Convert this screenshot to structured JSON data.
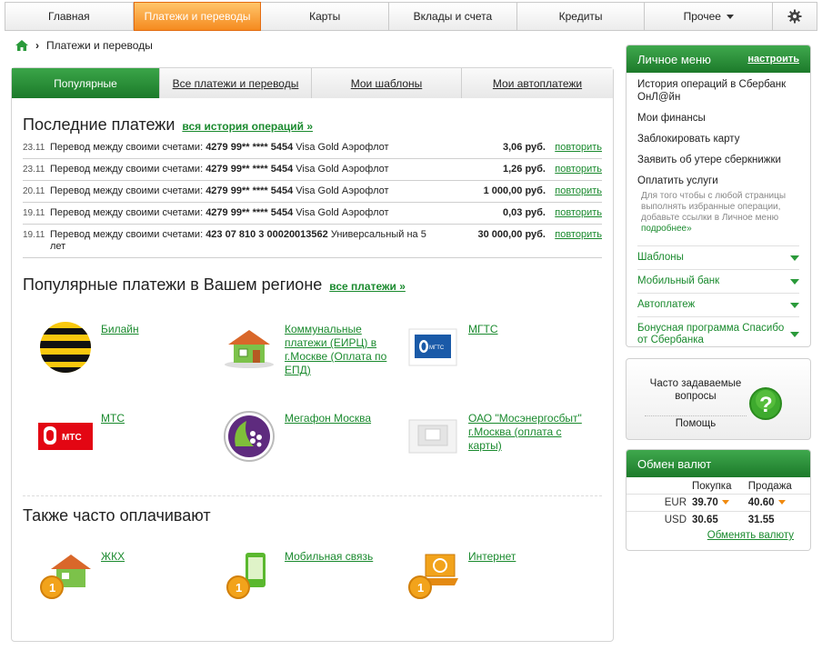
{
  "nav": {
    "items": [
      {
        "label": "Главная"
      },
      {
        "label": "Платежи и переводы"
      },
      {
        "label": "Карты"
      },
      {
        "label": "Вклады и счета"
      },
      {
        "label": "Кредиты"
      },
      {
        "label": "Прочее"
      }
    ],
    "settings_icon": "gear-icon"
  },
  "breadcrumb": {
    "home_icon": "home-icon",
    "current": "Платежи и переводы"
  },
  "tabs": [
    {
      "label": "Популярные"
    },
    {
      "label": "Все платежи и переводы"
    },
    {
      "label": "Мои шаблоны"
    },
    {
      "label": "Мои автоплатежи"
    }
  ],
  "recent": {
    "title": "Последние платежи",
    "history_link": "вся история операций »",
    "repeat_label": "повторить",
    "rows": [
      {
        "date": "23.11",
        "text": "Перевод между своими счетами:",
        "account": "4279 99** **** 5454",
        "card": "Visa Gold Аэрофлот",
        "amount": "3,06 руб."
      },
      {
        "date": "23.11",
        "text": "Перевод между своими счетами:",
        "account": "4279 99** **** 5454",
        "card": "Visa Gold Аэрофлот",
        "amount": "1,26 руб."
      },
      {
        "date": "20.11",
        "text": "Перевод между своими счетами:",
        "account": "4279 99** **** 5454",
        "card": "Visa Gold Аэрофлот",
        "amount": "1 000,00 руб."
      },
      {
        "date": "19.11",
        "text": "Перевод между своими счетами:",
        "account": "4279 99** **** 5454",
        "card": "Visa Gold Аэрофлот",
        "amount": "0,03 руб."
      },
      {
        "date": "19.11",
        "text": "Перевод между своими счетами:",
        "account": "423 07 810 3 00020013562",
        "card": "Универсальный на 5 лет",
        "amount": "30 000,00 руб."
      }
    ]
  },
  "regional": {
    "title": "Популярные платежи в Вашем регионе",
    "all_link": "все платежи »",
    "items": [
      {
        "label": "Билайн",
        "icon": "beeline-logo-icon"
      },
      {
        "label": "Коммунальные платежи (ЕИРЦ) в г.Москве (Оплата по ЕПД)",
        "icon": "house-icon"
      },
      {
        "label": "МГТС",
        "icon": "mgts-logo-icon"
      },
      {
        "label": "МТС",
        "icon": "mts-logo-icon"
      },
      {
        "label": "Мегафон Москва",
        "icon": "megafon-logo-icon"
      },
      {
        "label": "ОАО \"Мосэнергосбыт\" г.Москва (оплата с карты)",
        "icon": "mosenergosbyt-logo-icon"
      }
    ],
    "mgts_logo_text": "МГТС",
    "mts_logo_text": "МТС"
  },
  "frequent": {
    "title": "Также часто оплачивают",
    "items": [
      {
        "label": "ЖКХ",
        "icon": "house-coins-icon"
      },
      {
        "label": "Мобильная связь",
        "icon": "phone-coins-icon"
      },
      {
        "label": "Интернет",
        "icon": "laptop-coins-icon"
      }
    ]
  },
  "personal_menu": {
    "title": "Личное меню",
    "configure": "настроить",
    "links": [
      {
        "label": "История операций в Сбербанк ОнЛ@йн"
      },
      {
        "label": "Мои финансы"
      },
      {
        "label": "Заблокировать карту"
      },
      {
        "label": "Заявить об утере сберкнижки"
      },
      {
        "label": "Оплатить услуги"
      }
    ],
    "hint": "Для того чтобы с любой страницы выполнять избранные операции, добавьте ссылки в Личное меню",
    "hint_more": "подробнее»",
    "sections": [
      {
        "label": "Шаблоны"
      },
      {
        "label": "Мобильный банк"
      },
      {
        "label": "Автоплатеж"
      },
      {
        "label": "Бонусная программа Спасибо от Сбербанка"
      }
    ]
  },
  "faq": {
    "text": "Часто задаваемые вопросы",
    "help": "Помощь",
    "icon": "question-icon"
  },
  "fx": {
    "title": "Обмен валют",
    "col_buy": "Покупка",
    "col_sell": "Продажа",
    "rows": [
      {
        "cur": "EUR",
        "buy": "39.70",
        "sell": "40.60",
        "trend": "down"
      },
      {
        "cur": "USD",
        "buy": "30.65",
        "sell": "31.55",
        "trend": ""
      }
    ],
    "exchange_link": "Обменять валюту"
  },
  "colors": {
    "brand_green": "#1c7a2a",
    "accent_orange": "#f58a1f",
    "link_green": "#1a8a2e"
  }
}
